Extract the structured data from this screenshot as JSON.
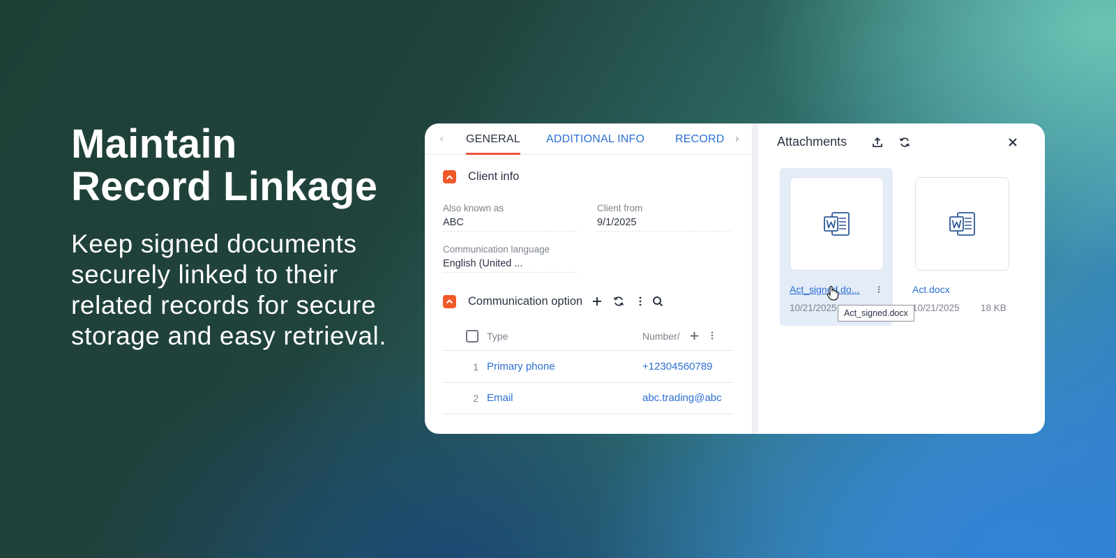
{
  "hero": {
    "title_line1": "Maintain",
    "title_line2": "Record Linkage",
    "subtitle_lines": [
      "Keep signed documents",
      "securely linked to their",
      "related records for secure",
      "storage and easy retrieval."
    ]
  },
  "tabs": {
    "prev_icon": "chevron-left-icon",
    "next_icon": "chevron-right-icon",
    "items": [
      {
        "label": "GENERAL",
        "active": true
      },
      {
        "label": "ADDITIONAL INFO",
        "active": false
      },
      {
        "label": "RECORD",
        "active": false
      }
    ]
  },
  "client_info": {
    "title": "Client info",
    "fields": [
      {
        "label": "Also known as",
        "value": "ABC"
      },
      {
        "label": "Client from",
        "value": "9/1/2025"
      },
      {
        "label": "Communication language",
        "value": "English (United ..."
      }
    ]
  },
  "communication": {
    "title": "Communication option",
    "columns": {
      "type": "Type",
      "number": "Number/"
    },
    "rows": [
      {
        "index": "1",
        "type": "Primary phone",
        "number": "+12304560789"
      },
      {
        "index": "2",
        "type": "Email",
        "number": "abc.trading@abc"
      }
    ]
  },
  "attachments": {
    "title": "Attachments",
    "files": [
      {
        "name": "Act_signed.do...",
        "date": "10/21/2025",
        "size": "",
        "selected": true
      },
      {
        "name": "Act.docx",
        "date": "10/21/2025",
        "size": "18 KB",
        "selected": false
      }
    ],
    "tooltip": "Act_signed.docx"
  },
  "colors": {
    "accent_orange": "#f05a2a",
    "link_blue": "#2b6fd1",
    "word_blue": "#2b5797"
  }
}
